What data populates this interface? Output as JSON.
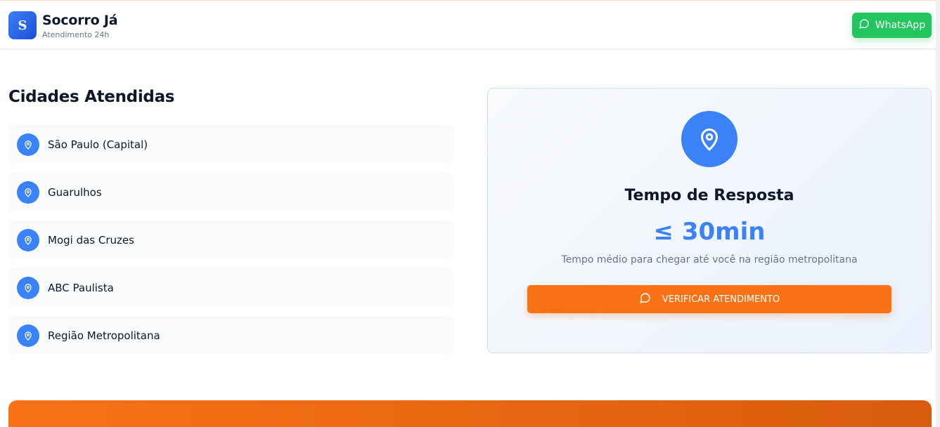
{
  "header": {
    "logo_letter": "S",
    "brand_name": "Socorro Já",
    "brand_tagline": "Atendimento 24h",
    "whatsapp_label": "WhatsApp"
  },
  "cities": {
    "title": "Cidades Atendidas",
    "items": [
      {
        "label": "São Paulo (Capital)",
        "icon": "map-pin-icon"
      },
      {
        "label": "Guarulhos",
        "icon": "map-pin-icon"
      },
      {
        "label": "Mogi das Cruzes",
        "icon": "map-pin-icon"
      },
      {
        "label": "ABC Paulista",
        "icon": "map-pin-icon"
      },
      {
        "label": "Região Metropolitana",
        "icon": "map-pin-icon"
      }
    ]
  },
  "response_card": {
    "icon": "map-pin-icon",
    "title": "Tempo de Resposta",
    "value": "≤ 30min",
    "description": "Tempo médio para chegar até você na região metropolitana",
    "button_label": "VERIFICAR ATENDIMENTO",
    "button_icon": "chat-icon"
  },
  "colors": {
    "primary_blue": "#3b82f6",
    "whatsapp_green": "#22c55e",
    "accent_orange": "#f97316"
  }
}
